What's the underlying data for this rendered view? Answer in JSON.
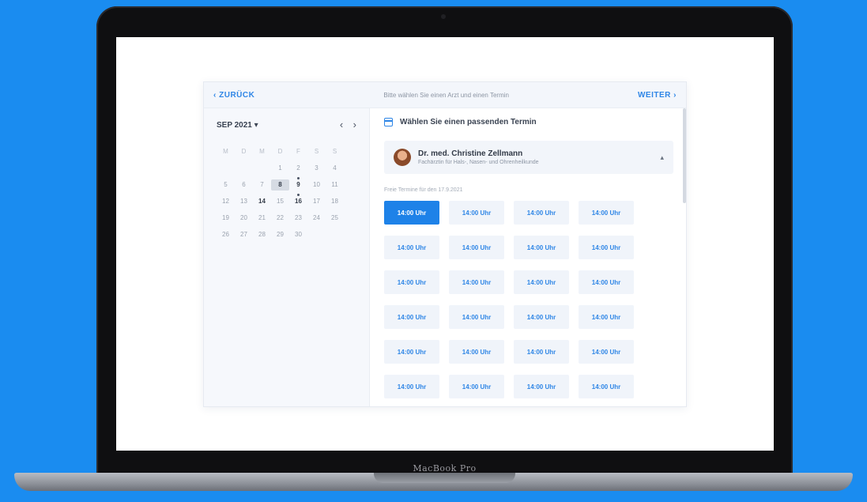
{
  "device": {
    "model_label": "MacBook Pro"
  },
  "topbar": {
    "back_label": "‹ ZURÜCK",
    "hint": "Bitte wählen Sie einen Arzt und einen Termin",
    "next_label": "WEITER ›"
  },
  "calendar": {
    "month_label": "SEP 2021 ▾",
    "prev_icon": "chevron-left-icon",
    "next_icon": "chevron-right-icon",
    "weekdays": [
      "M",
      "D",
      "M",
      "D",
      "F",
      "S",
      "S"
    ],
    "days": [
      "",
      "",
      "",
      "1",
      "2",
      "3",
      "4",
      "5",
      "6",
      "7",
      "8",
      "9",
      "10",
      "11",
      "12",
      "13",
      "14",
      "15",
      "16",
      "17",
      "18",
      "19",
      "20",
      "21",
      "22",
      "23",
      "24",
      "25",
      "26",
      "27",
      "28",
      "29",
      "30",
      "",
      ""
    ],
    "selected_day": "8",
    "marked_days": [
      "9",
      "16"
    ],
    "bold_days": [
      "8",
      "9",
      "14",
      "16"
    ]
  },
  "slots_pane": {
    "heading": "Wählen Sie einen passenden Termin",
    "doctor": {
      "name": "Dr. med. Christine Zellmann",
      "specialty": "Fachärztin für Hals-, Nasen- und Ohrenheilkunde",
      "avatar_icon": "avatar-icon",
      "toggle_icon": "chevron-up-icon"
    },
    "date_label": "Freie Termine für den 17.9.2021",
    "slot_rows": [
      [
        "14:00 Uhr",
        "14:00 Uhr",
        "14:00 Uhr",
        "14:00 Uhr"
      ],
      [
        "14:00 Uhr",
        "14:00 Uhr",
        "14:00 Uhr",
        "14:00 Uhr"
      ],
      [
        "14:00 Uhr",
        "14:00 Uhr",
        "14:00 Uhr",
        "14:00 Uhr"
      ],
      [
        "14:00 Uhr",
        "14:00 Uhr",
        "14:00 Uhr",
        "14:00 Uhr"
      ],
      [
        "14:00 Uhr",
        "14:00 Uhr",
        "14:00 Uhr",
        "14:00 Uhr"
      ],
      [
        "14:00 Uhr",
        "14:00 Uhr",
        "14:00 Uhr",
        "14:00 Uhr"
      ]
    ],
    "active_slot": "0-0"
  },
  "colors": {
    "background": "#1a8cf0",
    "accent": "#1e82e8",
    "link": "#2f86e6"
  }
}
